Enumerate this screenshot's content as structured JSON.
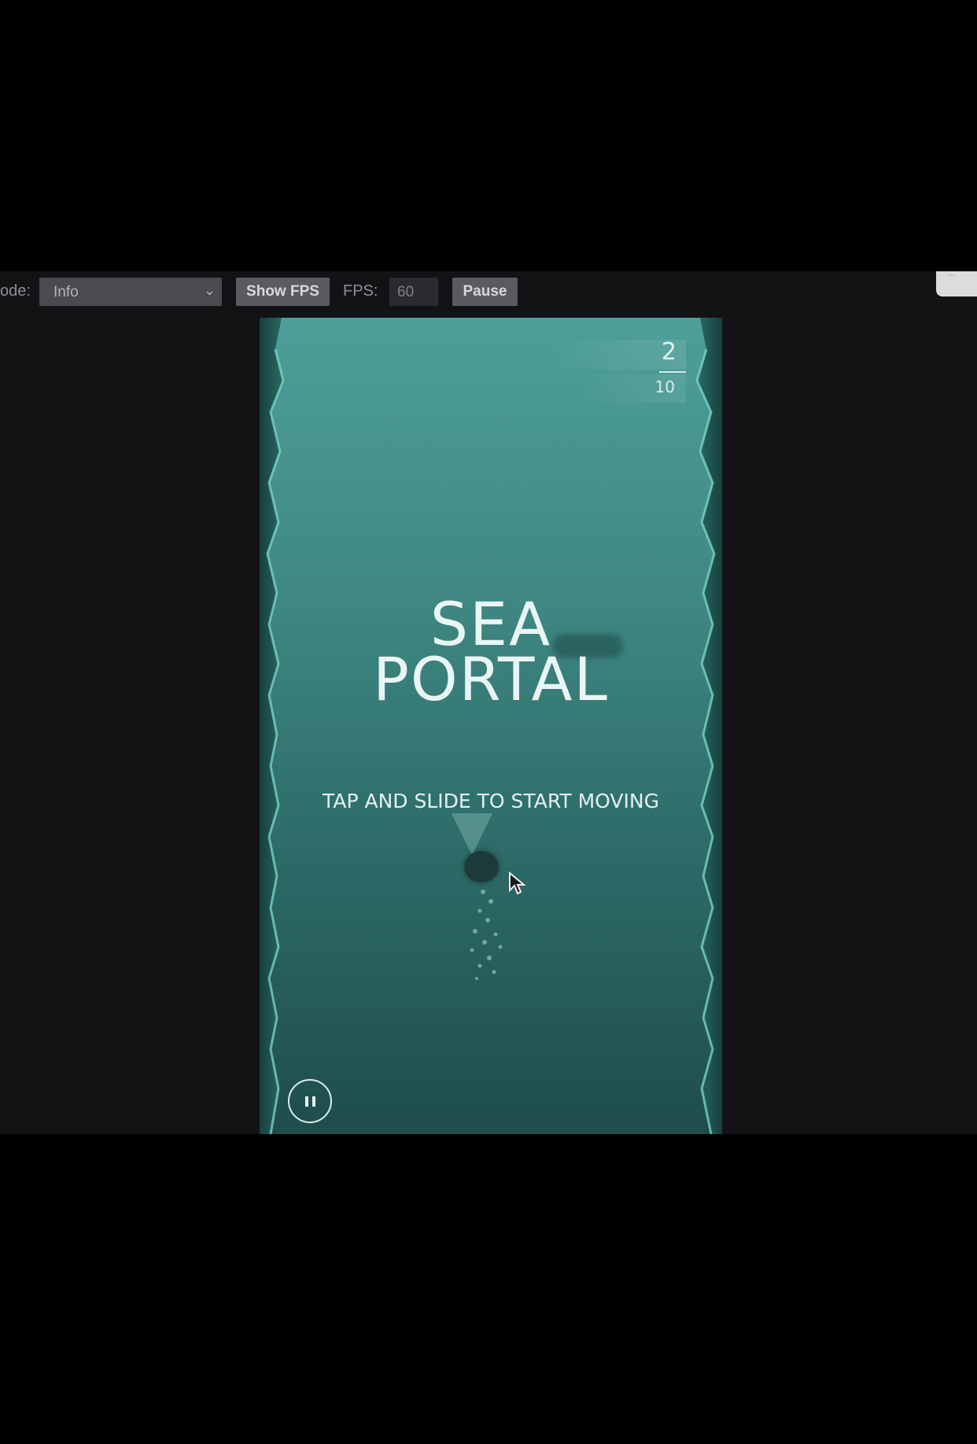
{
  "toolbar": {
    "mode_label": "ode:",
    "mode_value": "Info",
    "show_fps_label": "Show FPS",
    "fps_label": "FPS:",
    "fps_value": "60",
    "pause_label": "Pause"
  },
  "game": {
    "score": "2",
    "best": "10",
    "title_line1": "SEA",
    "title_line2": "PORTAL",
    "hint": "TAP AND SLIDE TO START MOVING"
  },
  "colors": {
    "water_top": "#4e9f99",
    "water_bottom": "#1f4d4b",
    "wall_dark": "#17403d",
    "wall_light": "#7fd9cb"
  },
  "icons": {
    "mode_dropdown": "chevron-down-icon",
    "submarine": "submarine-icon",
    "pause": "pause-icon",
    "cursor": "mouse-cursor-icon"
  }
}
